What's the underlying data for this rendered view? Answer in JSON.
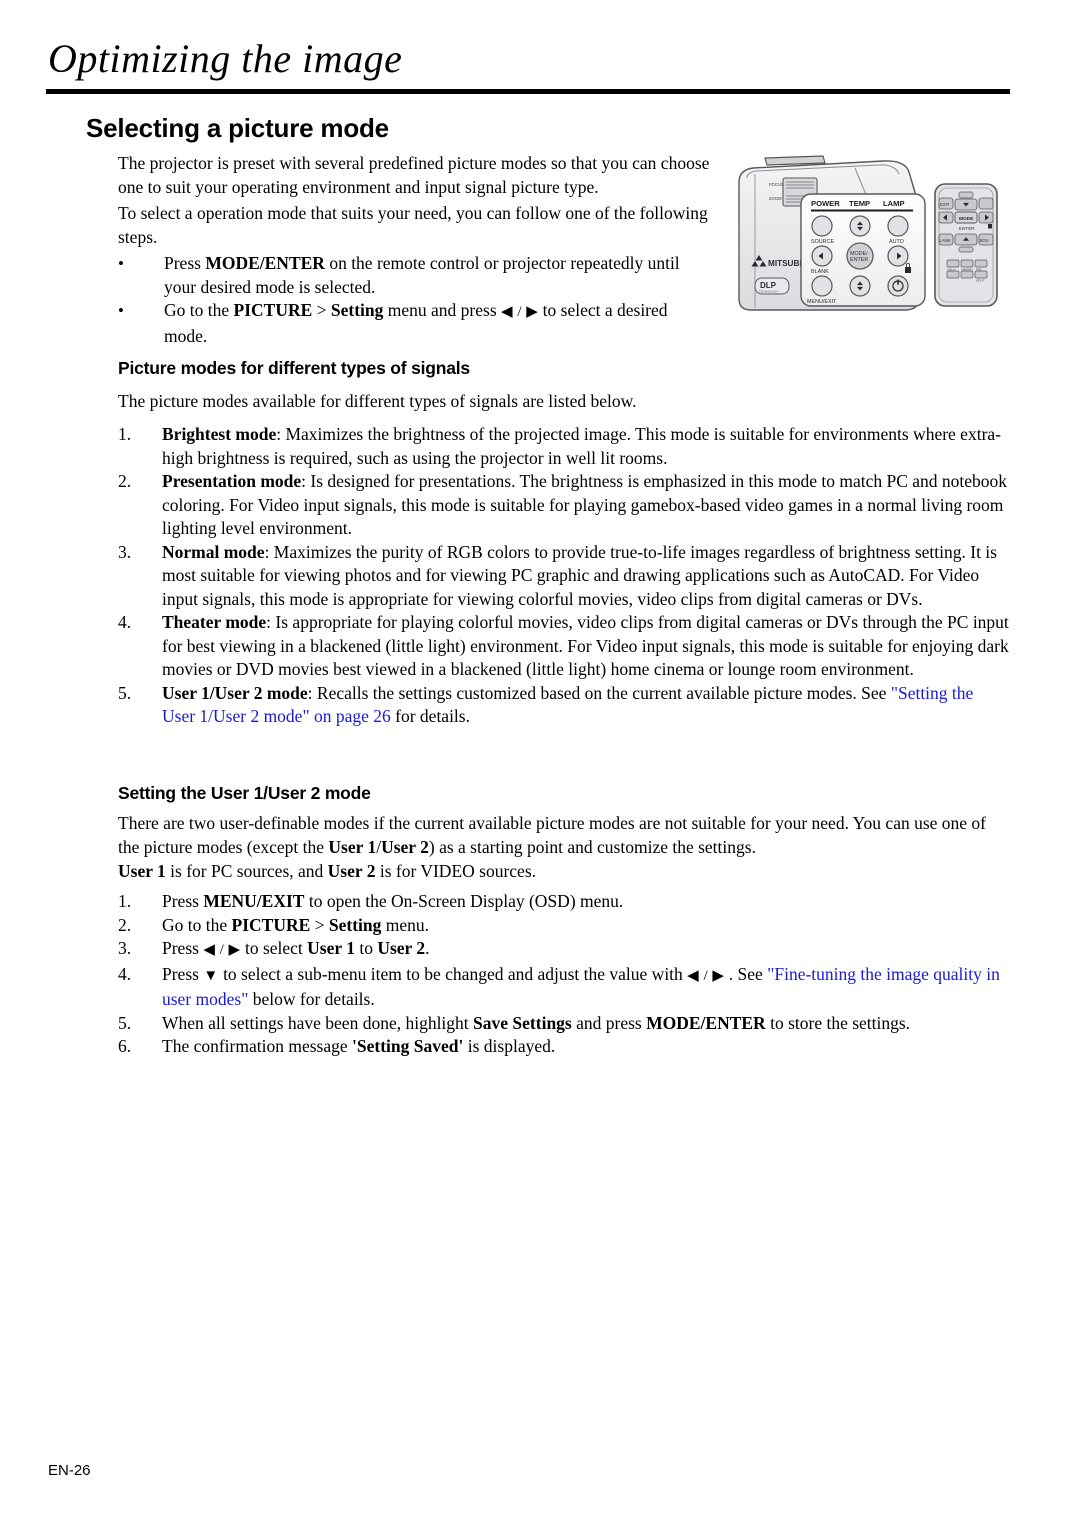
{
  "chapter": {
    "title": "Optimizing the image"
  },
  "sections": {
    "picture_mode": {
      "heading": "Selecting a picture mode",
      "intro_p1": "The projector is preset with several predefined picture modes so that you can choose one to suit your operating environment and input signal picture type.",
      "intro_p2": "To select a operation mode that suits your need, you can follow one of the following steps.",
      "bullets": [
        {
          "marker": "•",
          "parts": [
            {
              "text": "Press ",
              "style": "normal"
            },
            {
              "text": "MODE/ENTER",
              "style": "bold"
            },
            {
              "text": " on the remote control or projector repeatedly until your desired mode is selected.",
              "style": "normal"
            }
          ]
        },
        {
          "marker": "•",
          "parts": [
            {
              "text": "Go to the ",
              "style": "normal"
            },
            {
              "text": "PICTURE",
              "style": "bold"
            },
            {
              "text": " > ",
              "style": "normal"
            },
            {
              "text": "Setting",
              "style": "bold"
            },
            {
              "text": " menu and press ",
              "style": "normal"
            },
            {
              "text": "◀ / ▶",
              "style": "arrows"
            },
            {
              "text": " to select a desired mode.",
              "style": "normal"
            }
          ]
        }
      ]
    },
    "signals": {
      "heading": "Picture modes for different types of signals",
      "intro": "The picture modes available for different types of signals are listed below.",
      "items": [
        {
          "marker": "1.",
          "parts": [
            {
              "text": "Brightest mode",
              "style": "bold"
            },
            {
              "text": ": Maximizes the brightness of the projected image. This mode is suitable for environments where extra-high brightness is required, such as using the projector in well lit rooms.",
              "style": "normal"
            }
          ]
        },
        {
          "marker": "2.",
          "parts": [
            {
              "text": "Presentation mode",
              "style": "bold"
            },
            {
              "text": ": Is designed for presentations. The brightness is emphasized in this mode to match PC and notebook coloring. For Video input signals, this mode is suitable for playing gamebox-based video games in a normal living room lighting level environment.",
              "style": "normal"
            }
          ]
        },
        {
          "marker": "3.",
          "parts": [
            {
              "text": "Normal mode",
              "style": "bold"
            },
            {
              "text": ": Maximizes the purity of RGB colors to provide true-to-life images regardless of brightness setting. It is most suitable for viewing photos and for viewing PC graphic and drawing applications such as AutoCAD. For Video input signals, this mode is appropriate for viewing colorful movies, video clips from digital cameras or DVs.",
              "style": "normal"
            }
          ]
        },
        {
          "marker": "4.",
          "parts": [
            {
              "text": "Theater mode",
              "style": "bold"
            },
            {
              "text": ":  Is appropriate for playing colorful movies, video clips from digital cameras or DVs through the PC input for best viewing in a blackened (little light) environment. For Video input signals, this mode is suitable for enjoying dark movies or DVD movies best viewed in a blackened (little light) home cinema or lounge room environment.",
              "style": "normal"
            }
          ]
        },
        {
          "marker": "5.",
          "parts": [
            {
              "text": "User 1/User 2 mode",
              "style": "bold"
            },
            {
              "text": ": Recalls the settings customized based on the current available picture modes. See ",
              "style": "normal"
            },
            {
              "text": "\"Setting the User 1/User 2 mode\" on page 26",
              "style": "link"
            },
            {
              "text": " for details.",
              "style": "normal"
            }
          ]
        }
      ]
    },
    "user_mode": {
      "heading": "Setting the User 1/User 2 mode",
      "intro_parts": [
        {
          "text": "There are two user-definable modes if the current available picture modes are not suitable for your need. You can use one of the picture modes (except the ",
          "style": "normal"
        },
        {
          "text": "User 1",
          "style": "bold"
        },
        {
          "text": "/",
          "style": "normal"
        },
        {
          "text": "User 2",
          "style": "bold"
        },
        {
          "text": ") as a starting point and customize the settings.",
          "style": "normal"
        }
      ],
      "note_parts": [
        {
          "text": "User 1",
          "style": "bold"
        },
        {
          "text": " is for PC sources, and ",
          "style": "normal"
        },
        {
          "text": "User 2",
          "style": "bold"
        },
        {
          "text": " is for VIDEO sources.",
          "style": "normal"
        }
      ],
      "items": [
        {
          "marker": "1.",
          "parts": [
            {
              "text": "Press ",
              "style": "normal"
            },
            {
              "text": "MENU/EXIT",
              "style": "bold"
            },
            {
              "text": " to open the On-Screen Display (OSD) menu.",
              "style": "normal"
            }
          ]
        },
        {
          "marker": "2.",
          "parts": [
            {
              "text": "Go to the ",
              "style": "normal"
            },
            {
              "text": "PICTURE",
              "style": "bold"
            },
            {
              "text": " > ",
              "style": "normal"
            },
            {
              "text": "Setting",
              "style": "bold"
            },
            {
              "text": " menu.",
              "style": "normal"
            }
          ]
        },
        {
          "marker": "3.",
          "parts": [
            {
              "text": "Press ",
              "style": "normal"
            },
            {
              "text": "◀ / ▶",
              "style": "arrows"
            },
            {
              "text": " to select ",
              "style": "normal"
            },
            {
              "text": "User 1",
              "style": "bold"
            },
            {
              "text": " to ",
              "style": "normal"
            },
            {
              "text": "User 2",
              "style": "bold"
            },
            {
              "text": ".",
              "style": "normal"
            }
          ]
        },
        {
          "marker": "4.",
          "parts": [
            {
              "text": "Press ",
              "style": "normal"
            },
            {
              "text": "▼",
              "style": "arrows"
            },
            {
              "text": " to select a sub-menu item to be changed and adjust the value with ",
              "style": "normal"
            },
            {
              "text": "◀ / ▶",
              "style": "arrows"
            },
            {
              "text": " . See ",
              "style": "normal"
            },
            {
              "text": "\"Fine-tuning the image quality in user modes\"",
              "style": "link"
            },
            {
              "text": " below for details.",
              "style": "normal"
            }
          ]
        },
        {
          "marker": "5.",
          "parts": [
            {
              "text": "When all settings have been done, highlight ",
              "style": "normal"
            },
            {
              "text": "Save Settings",
              "style": "bold"
            },
            {
              "text": " and press ",
              "style": "normal"
            },
            {
              "text": "MODE/ENTER",
              "style": "bold"
            },
            {
              "text": " to store the settings.",
              "style": "normal"
            }
          ]
        },
        {
          "marker": "6.",
          "parts": [
            {
              "text": "The confirmation message ",
              "style": "normal"
            },
            {
              "text": "'Setting Saved'",
              "style": "bold"
            },
            {
              "text": " is displayed.",
              "style": "normal"
            }
          ]
        }
      ]
    }
  },
  "illustration": {
    "brand": "MITSUBISHI",
    "dlp_badge": "DLP",
    "dlp_sub": "TECHNOLOGY",
    "focus_label": "FOCUS",
    "zoom_label": "ZOOM",
    "indicators": [
      "POWER",
      "TEMP",
      "LAMP"
    ],
    "panel_buttons": [
      "SOURCE",
      "AUTO",
      "BLANK",
      "MODE/ENTER",
      "MENU/EXIT"
    ],
    "remote_buttons": [
      "EXIT",
      "MODE",
      "ENTER",
      "BLANK",
      "SOURCE",
      "VOL-/+",
      "MAGNIFY",
      "FREEZE",
      "KEYSTONE"
    ]
  },
  "footer": {
    "page_label": "EN-26"
  },
  "colors": {
    "link": "#1a19d6",
    "text": "#000000",
    "rule": "#000000",
    "device_body": "#e8e8ea",
    "device_outline": "#58585a"
  }
}
